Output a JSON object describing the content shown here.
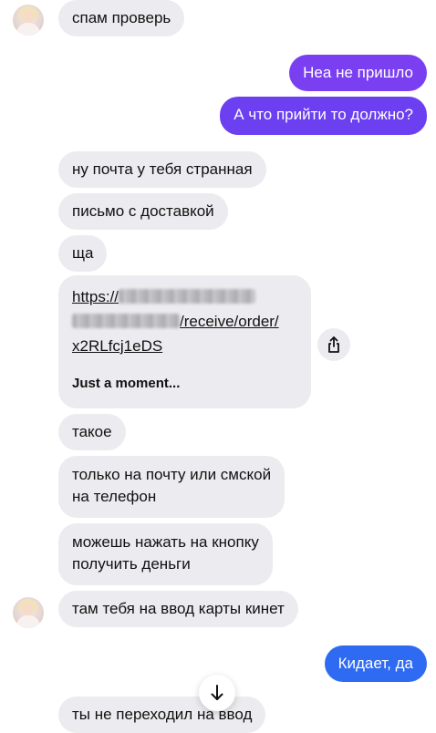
{
  "messages": {
    "m1": "спам проверь",
    "m2": "Неа не пришло",
    "m3": "А что прийти то должно?",
    "m4": "ну почта у тебя странная",
    "m5": "письмо с доставкой",
    "m6": "ща",
    "link": {
      "line1_prefix": "https://",
      "line2_suffix": "/receive/order/",
      "line3": "x2RLfcj1eDS",
      "preview_title": "Just a moment..."
    },
    "m7": "такое",
    "m8_line1": "только на почту или смской",
    "m8_line2": "на телефон",
    "m9_line1": "можешь нажать на кнопку",
    "m9_line2": "получить деньги",
    "m10": "там тебя на ввод карты кинет",
    "m11": "Кидает, да",
    "m12": "ты не переходил на ввод"
  },
  "icons": {
    "share": "share-icon",
    "scroll_down": "arrow-down-icon"
  },
  "colors": {
    "incoming_bubble": "#ececf0",
    "outgoing_purple": "#7b3ff2",
    "outgoing_blue": "#2f6af2"
  }
}
